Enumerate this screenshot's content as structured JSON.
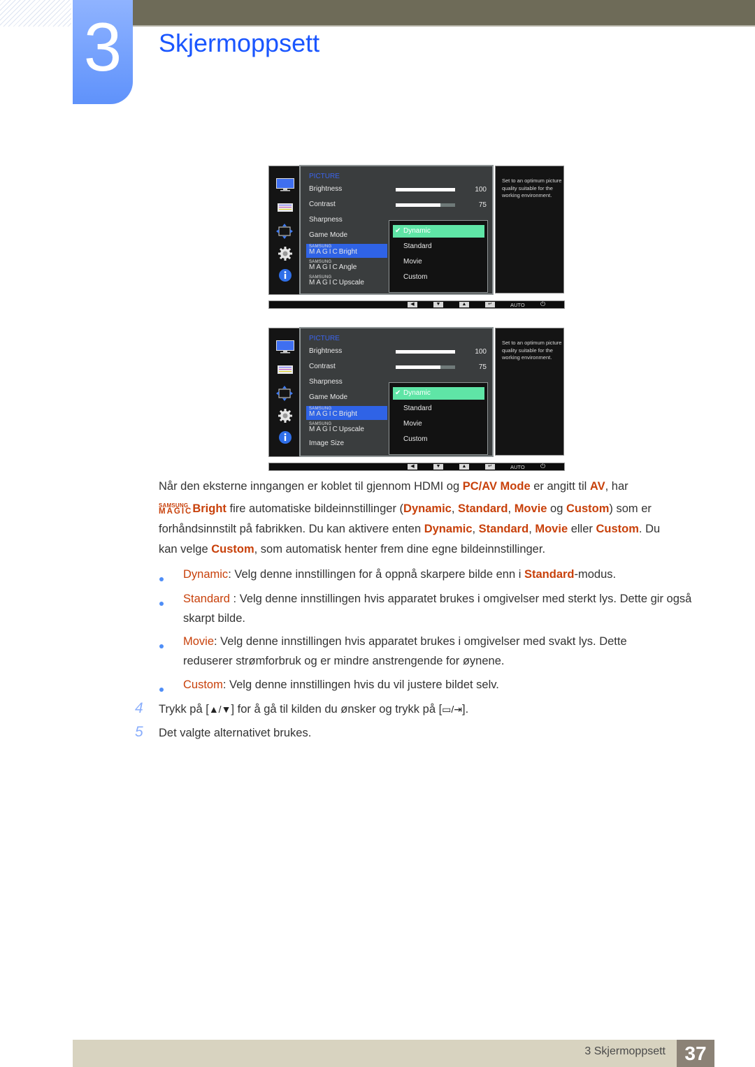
{
  "header": {
    "chapter_number": "3",
    "chapter_title": "Skjermoppsett"
  },
  "osd_screens": [
    {
      "menu_title": "PICTURE",
      "items": [
        {
          "label": "Brightness",
          "type": "slider",
          "value": "100",
          "percent": 100
        },
        {
          "label": "Contrast",
          "type": "slider",
          "value": "75",
          "percent": 75
        },
        {
          "label": "Sharpness"
        },
        {
          "label": "Game Mode"
        },
        {
          "magic": true,
          "label": "Bright",
          "selected": true
        },
        {
          "magic": true,
          "label": "Angle"
        },
        {
          "magic": true,
          "label": "Upscale"
        }
      ],
      "dropdown": [
        {
          "label": "Dynamic",
          "selected": true
        },
        {
          "label": "Standard"
        },
        {
          "label": "Movie"
        },
        {
          "label": "Custom"
        }
      ],
      "help_text": "Set to an optimum picture quality suitable for the working environment."
    },
    {
      "menu_title": "PICTURE",
      "items": [
        {
          "label": "Brightness",
          "type": "slider",
          "value": "100",
          "percent": 100
        },
        {
          "label": "Contrast",
          "type": "slider",
          "value": "75",
          "percent": 75
        },
        {
          "label": "Sharpness"
        },
        {
          "label": "Game Mode"
        },
        {
          "magic": true,
          "label": "Bright",
          "selected": true
        },
        {
          "magic": true,
          "label": "Upscale"
        },
        {
          "label": "Image Size"
        }
      ],
      "dropdown": [
        {
          "label": "Dynamic",
          "selected": true
        },
        {
          "label": "Standard"
        },
        {
          "label": "Movie"
        },
        {
          "label": "Custom"
        }
      ],
      "help_text": "Set to an optimum picture quality suitable for the working environment."
    }
  ],
  "osd_common": {
    "magic_top": "SAMSUNG",
    "magic_bottom": "MAGIC",
    "buttons": {
      "left": "◀",
      "down": "▼",
      "up": "▲",
      "enter": "↵",
      "auto": "AUTO",
      "power": "⏻"
    },
    "check": "✔"
  },
  "intro": {
    "l1_a": "Når den eksterne inngangen er koblet til gjennom HDMI og ",
    "l1_b": "PC/AV Mode",
    "l1_c": " er angitt til ",
    "l1_d": "AV",
    "l1_e": ", har",
    "magic_top": "SAMSUNG",
    "magic_bottom": "MAGIC",
    "l2_bright": "Bright",
    "l2_a": " fire automatiske bildeinnstillinger (",
    "dynamic": "Dynamic",
    "standard": "Standard",
    "movie": "Movie",
    "custom": "Custom",
    "comma": ", ",
    "og": " og ",
    "l2_b": ") som er",
    "l3_a": "forhåndsinnstilt på fabrikken. Du kan aktivere enten ",
    "eller": " eller ",
    "l3_b": ". Du",
    "l4_a": "kan velge ",
    "l4_b": ", som automatisk henter frem dine egne bildeinnstillinger."
  },
  "bullets": [
    {
      "term": "Dynamic",
      "text": ": Velg denne innstillingen for å oppnå skarpere bilde enn i ",
      "term2": "Standard",
      "text2": "-modus."
    },
    {
      "term": "Standard",
      "text": " : Velg denne innstillingen hvis apparatet brukes i omgivelser med sterkt lys. Dette gir også skarpt bilde."
    },
    {
      "term": "Movie",
      "text": ": Velg denne innstillingen hvis apparatet brukes i omgivelser med svakt lys. Dette reduserer strømforbruk og er mindre anstrengende for øynene."
    },
    {
      "term": "Custom",
      "text": ": Velg denne innstillingen hvis du vil justere bildet selv."
    }
  ],
  "steps": [
    {
      "num": "4",
      "a": "Trykk på [",
      "g1": "▲/▼",
      "b": "] for å gå til kilden du ønsker og trykk på [",
      "g2": "▭/⇥",
      "c": "]."
    },
    {
      "num": "5",
      "a": "Det valgte alternativet brukes."
    }
  ],
  "footer": {
    "label": "3 Skjermoppsett",
    "page": "37"
  },
  "colors": {
    "accent_blue": "#1a56ff",
    "highlight_orange": "#c8410b",
    "osd_selected_blue": "#2f63e6",
    "osd_dropdown_green": "#5fe5a6"
  }
}
